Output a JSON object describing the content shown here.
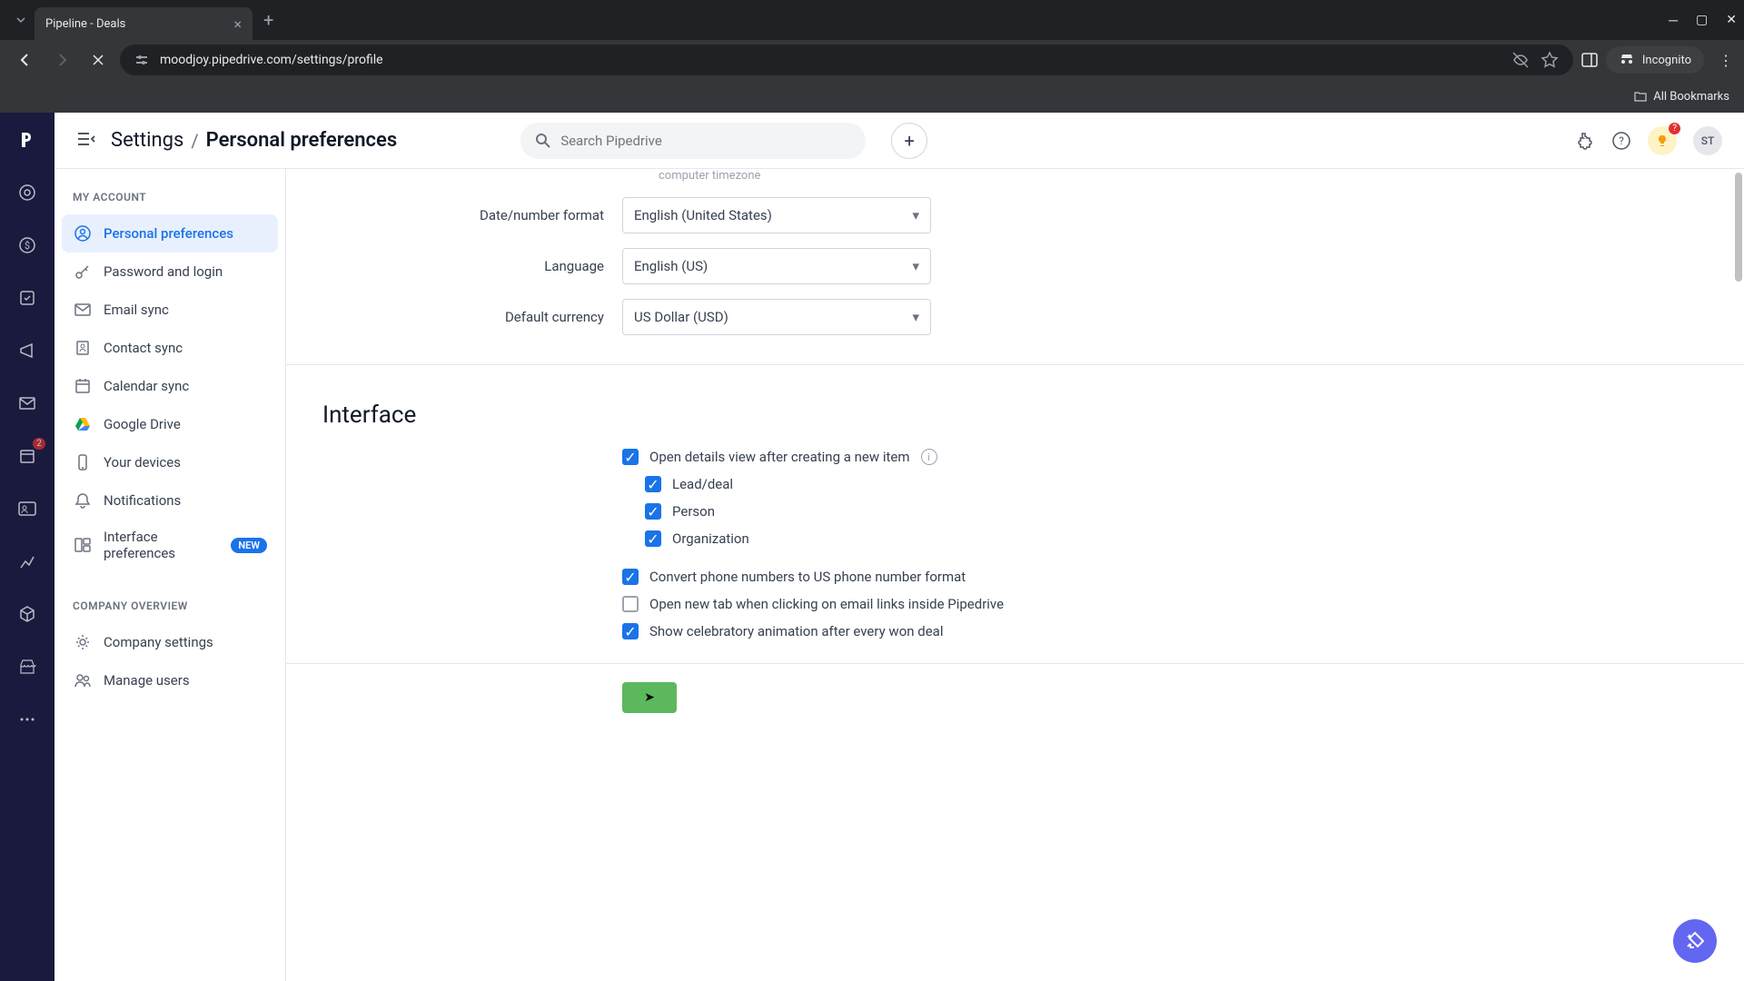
{
  "browser": {
    "tab_title": "Pipeline - Deals",
    "url": "moodjoy.pipedrive.com/settings/profile",
    "incognito_label": "Incognito",
    "all_bookmarks": "All Bookmarks"
  },
  "header": {
    "breadcrumb_parent": "Settings",
    "breadcrumb_current": "Personal preferences",
    "search_placeholder": "Search Pipedrive",
    "avatar_initials": "ST",
    "bulb_badge": "?"
  },
  "rail": {
    "badge_count": "2"
  },
  "sidebar": {
    "section1_title": "MY ACCOUNT",
    "items1": [
      {
        "label": "Personal preferences"
      },
      {
        "label": "Password and login"
      },
      {
        "label": "Email sync"
      },
      {
        "label": "Contact sync"
      },
      {
        "label": "Calendar sync"
      },
      {
        "label": "Google Drive"
      },
      {
        "label": "Your devices"
      },
      {
        "label": "Notifications"
      },
      {
        "label": "Interface preferences",
        "badge": "NEW"
      }
    ],
    "section2_title": "COMPANY OVERVIEW",
    "items2": [
      {
        "label": "Company settings"
      },
      {
        "label": "Manage users"
      }
    ]
  },
  "form": {
    "hint_computer_tz": "computer timezone",
    "date_format_label": "Date/number format",
    "date_format_value": "English (United States)",
    "language_label": "Language",
    "language_value": "English (US)",
    "currency_label": "Default currency",
    "currency_value": "US Dollar (USD)",
    "interface_title": "Interface",
    "checkboxes": {
      "open_details": {
        "label": "Open details view after creating a new item",
        "checked": true
      },
      "lead_deal": {
        "label": "Lead/deal",
        "checked": true
      },
      "person": {
        "label": "Person",
        "checked": true
      },
      "organization": {
        "label": "Organization",
        "checked": true
      },
      "convert_phone": {
        "label": "Convert phone numbers to US phone number format",
        "checked": true
      },
      "open_new_tab": {
        "label": "Open new tab when clicking on email links inside Pipedrive",
        "checked": false
      },
      "celebratory": {
        "label": "Show celebratory animation after every won deal",
        "checked": true
      }
    }
  }
}
